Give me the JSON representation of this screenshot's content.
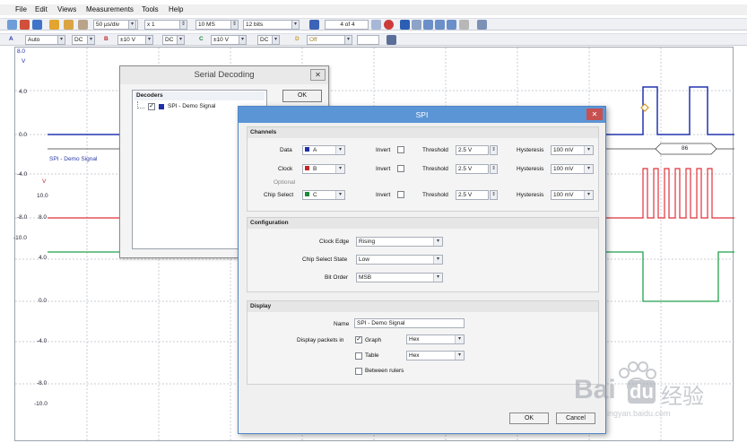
{
  "menu": [
    "File",
    "Edit",
    "Views",
    "Measurements",
    "Tools",
    "Help"
  ],
  "toolbar1": {
    "timebase": "50 µs/div",
    "zoom": "x 1",
    "samples": "10 MS",
    "resolution": "12 bits",
    "capture": "4 of 4"
  },
  "toolbar2": {
    "chA_label": "A",
    "chA_range": "Auto",
    "chA_coupling": "DC",
    "chB_label": "B",
    "chB_range": "±10 V",
    "chB_coupling": "DC",
    "chC_label": "C",
    "chC_range": "±10 V",
    "chC_coupling": "DC",
    "chD_label": "D",
    "chD_range": "Off"
  },
  "scope": {
    "y_left": [
      "8.0",
      "V",
      "4.0",
      "0.0",
      "-4.0",
      "V",
      "-8.0",
      "-10.0",
      "4.0",
      "0.0",
      "-4.0",
      "-8.0",
      "-10.0"
    ],
    "y_inner": [
      "10.0",
      "8.0"
    ],
    "decode_label": "SPI - Demo Signal",
    "decode_value": "86"
  },
  "serial_dialog": {
    "title": "Serial Decoding",
    "decoders_header": "Decoders",
    "decoder_item": "SPI - Demo Signal",
    "ok": "OK"
  },
  "spi": {
    "title": "SPI",
    "channels_header": "Channels",
    "rows": [
      {
        "label": "Data",
        "channel": "A",
        "color": "#1f2fa8",
        "threshold": "2.5 V",
        "hysteresis": "100 mV"
      },
      {
        "label": "Clock",
        "channel": "B",
        "color": "#c0272d",
        "threshold": "2.5 V",
        "hysteresis": "100 mV"
      },
      {
        "label": "Chip Select",
        "channel": "C",
        "color": "#1e8a3c",
        "threshold": "2.5 V",
        "hysteresis": "100 mV"
      }
    ],
    "optional": "Optional",
    "invert": "Invert",
    "threshold": "Threshold",
    "hysteresis": "Hysteresis",
    "config_header": "Configuration",
    "clock_edge_label": "Clock Edge",
    "clock_edge": "Rising",
    "cs_state_label": "Chip Select State",
    "cs_state": "Low",
    "bit_order_label": "Bit Order",
    "bit_order": "MSB",
    "display_header": "Display",
    "name_label": "Name",
    "name_value": "SPI - Demo Signal",
    "packets_label": "Display packets in",
    "graph": "Graph",
    "graph_format": "Hex",
    "table": "Table",
    "table_format": "Hex",
    "between_rulers": "Between rulers",
    "ok": "OK",
    "cancel": "Cancel"
  },
  "watermark": {
    "brand": "Bai",
    "brand2": "du",
    "cn": "经验",
    "url": "jingyan.baidu.com"
  },
  "colors": {
    "channel_a": "#1f2fa8",
    "channel_b": "#d9252f",
    "channel_c": "#1e9a47",
    "title_blue": "#5b95d6"
  }
}
